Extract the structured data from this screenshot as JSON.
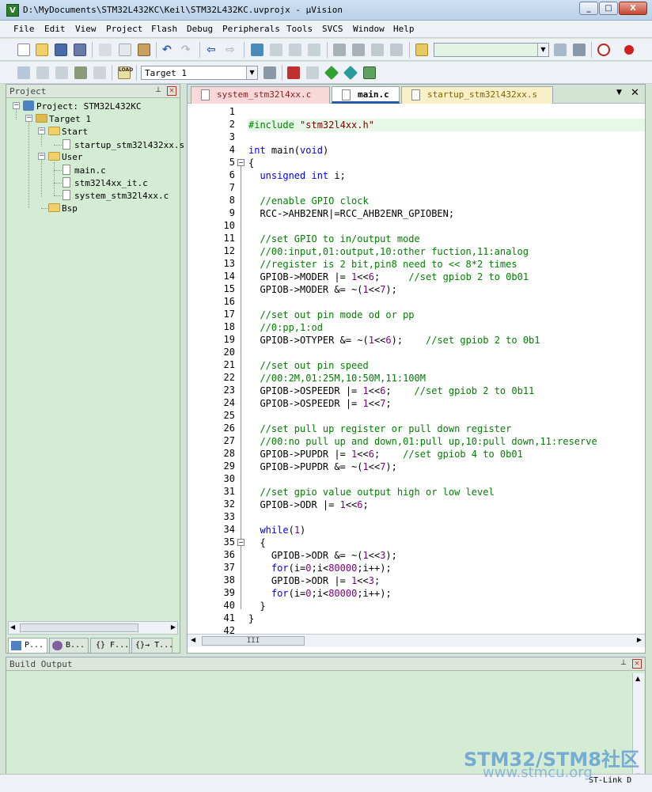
{
  "window": {
    "title": "D:\\MyDocuments\\STM32L432KC\\Keil\\STM32L432KC.uvprojx - µVision",
    "app_icon": "V",
    "min": "_",
    "max": "□",
    "close": "X"
  },
  "menu": [
    "File",
    "Edit",
    "View",
    "Project",
    "Flash",
    "Debug",
    "Peripherals",
    "Tools",
    "SVCS",
    "Window",
    "Help"
  ],
  "toolbar2": {
    "target_label": "Target 1"
  },
  "project_panel": {
    "title": "Project",
    "root": "Project: STM32L432KC",
    "target": "Target 1",
    "groups": [
      {
        "name": "Start",
        "files": [
          "startup_stm32l432xx.s"
        ]
      },
      {
        "name": "User",
        "files": [
          "main.c",
          "stm32l4xx_it.c",
          "system_stm32l4xx.c"
        ]
      },
      {
        "name": "Bsp",
        "files": []
      }
    ],
    "tabs": [
      "P...",
      "B...",
      "{} F...",
      "{}→ T..."
    ]
  },
  "editor": {
    "tabs": [
      {
        "label": "system_stm32l4xx.c",
        "active": false
      },
      {
        "label": "main.c",
        "active": true
      },
      {
        "label": "startup_stm32l432xx.s",
        "active": false
      }
    ],
    "menu_arrow": "▼",
    "close": "✕",
    "scroll_mark": "III",
    "lines": [
      "",
      "#include \"stm32l4xx.h\"",
      "",
      "int main(void)",
      "{",
      "  unsigned int i;",
      "",
      "  //enable GPIO clock",
      "  RCC->AHB2ENR|=RCC_AHB2ENR_GPIOBEN;",
      "",
      "  //set GPIO to in/output mode",
      "  //00:input,01:output,10:other fuction,11:analog",
      "  //register is 2 bit,pin8 need to << 8*2 times",
      "  GPIOB->MODER |= 1<<6;     //set gpiob 2 to 0b01",
      "  GPIOB->MODER &= ~(1<<7);",
      "",
      "  //set out pin mode od or pp",
      "  //0:pp,1:od",
      "  GPIOB->OTYPER &= ~(1<<6);    //set gpiob 2 to 0b1",
      "",
      "  //set out pin speed",
      "  //00:2M,01:25M,10:50M,11:100M",
      "  GPIOB->OSPEEDR |= 1<<6;    //set gpiob 2 to 0b11",
      "  GPIOB->OSPEEDR |= 1<<7;",
      "",
      "  //set pull up register or pull down register",
      "  //00:no pull up and down,01:pull up,10:pull down,11:reserve",
      "  GPIOB->PUPDR |= 1<<6;    //set gpiob 4 to 0b01",
      "  GPIOB->PUPDR &= ~(1<<7);",
      "",
      "  //set gpio value output high or low level",
      "  GPIOB->ODR |= 1<<6;",
      "",
      "  while(1)",
      "  {",
      "    GPIOB->ODR &= ~(1<<3);",
      "    for(i=0;i<80000;i++);",
      "    GPIOB->ODR |= 1<<3;",
      "    for(i=0;i<80000;i++);",
      "  }",
      "}",
      ""
    ]
  },
  "build_output": {
    "title": "Build Output"
  },
  "status": {
    "debugger": "ST-Link D"
  },
  "watermark": {
    "line1": "STM32/STM8社区",
    "line2": "www.stmcu.org"
  }
}
